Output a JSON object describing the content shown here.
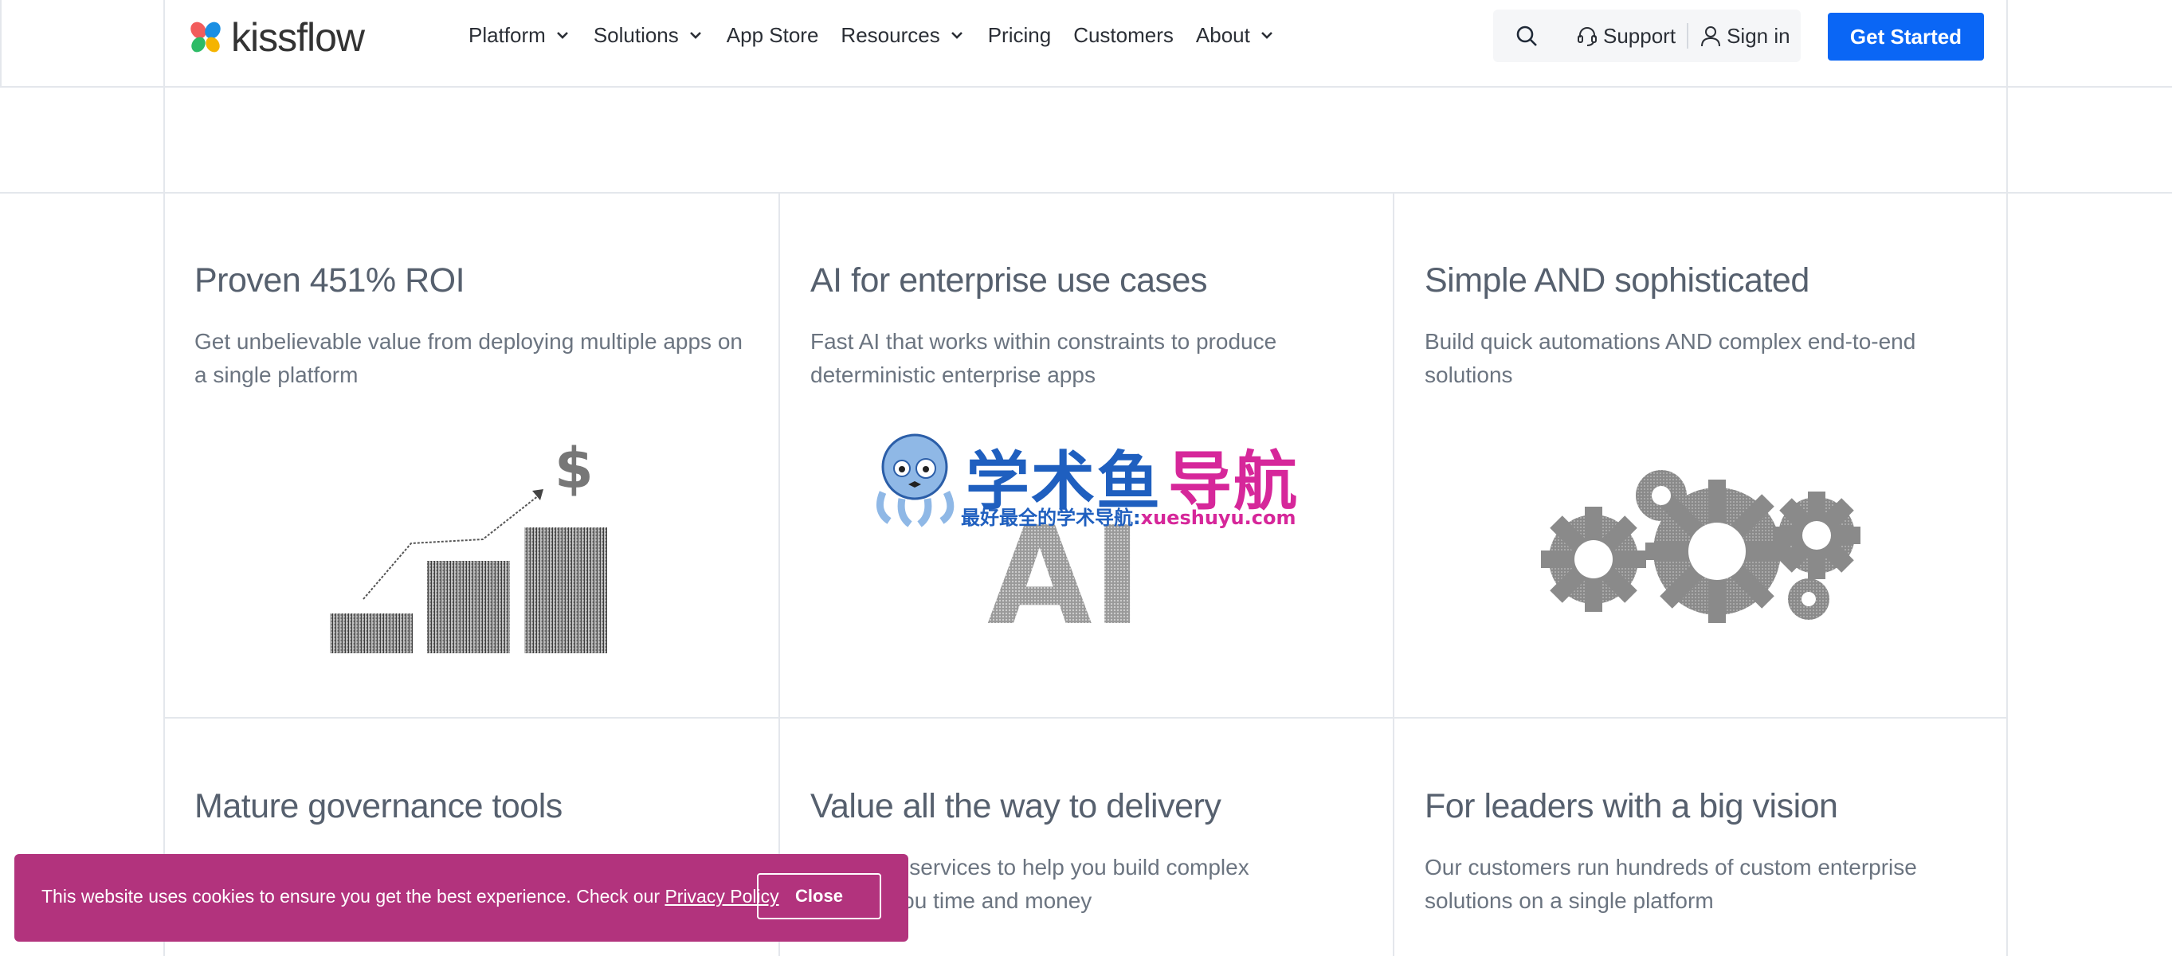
{
  "header": {
    "logo_text": "kissflow",
    "nav": [
      {
        "label": "Platform",
        "has_dropdown": true
      },
      {
        "label": "Solutions",
        "has_dropdown": true
      },
      {
        "label": "App Store",
        "has_dropdown": false
      },
      {
        "label": "Resources",
        "has_dropdown": true
      },
      {
        "label": "Pricing",
        "has_dropdown": false
      },
      {
        "label": "Customers",
        "has_dropdown": false
      },
      {
        "label": "About",
        "has_dropdown": true
      }
    ],
    "support_label": "Support",
    "signin_label": "Sign in",
    "cta_label": "Get Started",
    "icons": {
      "search": "search-icon",
      "support": "headset-icon",
      "signin": "user-icon",
      "dropdown": "chevron-down-icon"
    }
  },
  "cards": [
    {
      "title": "Proven 451% ROI",
      "description": "Get unbelievable value from deploying multiple apps on a single platform",
      "illustration": "growth-chart-illustration"
    },
    {
      "title": "AI for enterprise use cases",
      "description": "Fast AI that works within constraints to produce deterministic enterprise apps",
      "illustration": "ai-text-illustration",
      "illustration_text": "AI"
    },
    {
      "title": "Simple AND sophisticated",
      "description": "Build quick automations AND complex end-to-end solutions",
      "illustration": "gears-illustration"
    },
    {
      "title": "Mature governance tools",
      "description": "",
      "illustration": ""
    },
    {
      "title": "Value all the way to delivery",
      "description": "dable services to help you build complex",
      "description_line2": "ing you time and money",
      "illustration": ""
    },
    {
      "title": "For leaders with a big vision",
      "description": "Our customers run hundreds of custom enterprise solutions on a single platform",
      "illustration": ""
    }
  ],
  "watermark": {
    "title_part1": "学术鱼",
    "title_part2": "导航",
    "subtitle": "最好最全的学术导航:",
    "url": "xueshuyu.com"
  },
  "cookie_banner": {
    "text": "This website uses cookies to ensure you get the best experience. Check our",
    "link_label": "Privacy Policy",
    "close_label": "Close"
  },
  "colors": {
    "brand_blue": "#0a66f5",
    "cookie_bg": "#b2337d",
    "title_gray": "#56606e",
    "text_gray": "#6b7480"
  }
}
